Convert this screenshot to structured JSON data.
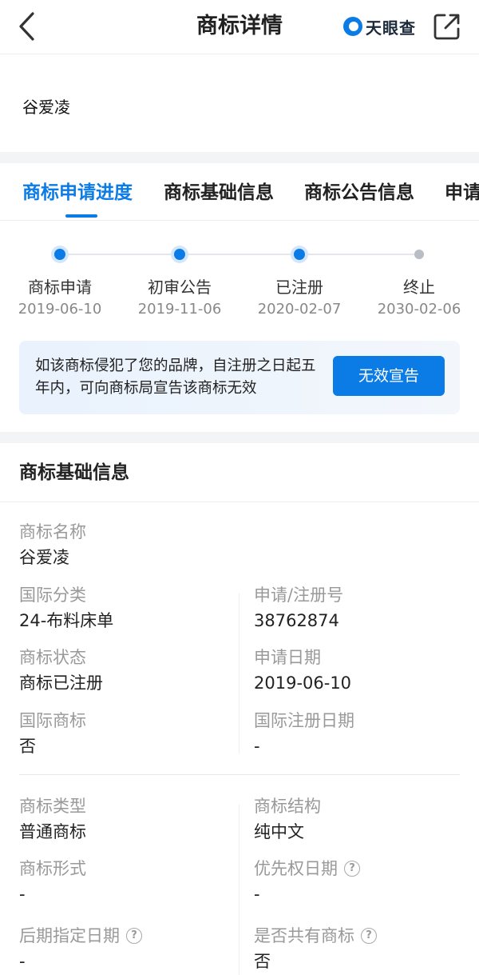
{
  "header": {
    "title": "商标详情",
    "brand_name": "天眼查",
    "back_icon": "chevron-left-icon",
    "share_icon": "share-out-icon"
  },
  "trademark": {
    "name_image_text": "谷爱凌"
  },
  "tabs": [
    {
      "label": "商标申请进度",
      "active": true
    },
    {
      "label": "商标基础信息",
      "active": false
    },
    {
      "label": "商标公告信息",
      "active": false
    },
    {
      "label": "申请",
      "active": false
    }
  ],
  "timeline": [
    {
      "label": "商标申请",
      "date": "2019-06-10",
      "done": true
    },
    {
      "label": "初审公告",
      "date": "2019-11-06",
      "done": true
    },
    {
      "label": "已注册",
      "date": "2020-02-07",
      "done": true
    },
    {
      "label": "终止",
      "date": "2030-02-06",
      "done": false
    }
  ],
  "notice": {
    "text": "如该商标侵犯了您的品牌，自注册之日起五年内，可向商标局宣告该商标无效",
    "button_label": "无效宣告"
  },
  "basic_info": {
    "section_title": "商标基础信息",
    "tm_name": {
      "label": "商标名称",
      "value": "谷爱凌"
    },
    "intl_class": {
      "label": "国际分类",
      "value": "24-布料床单"
    },
    "reg_no": {
      "label": "申请/注册号",
      "value": "38762874"
    },
    "status": {
      "label": "商标状态",
      "value": "商标已注册"
    },
    "apply_date": {
      "label": "申请日期",
      "value": "2019-06-10"
    },
    "intl_tm": {
      "label": "国际商标",
      "value": "否"
    },
    "intl_reg_date": {
      "label": "国际注册日期",
      "value": "-"
    },
    "tm_type": {
      "label": "商标类型",
      "value": "普通商标"
    },
    "tm_structure": {
      "label": "商标结构",
      "value": "纯中文"
    },
    "tm_form": {
      "label": "商标形式",
      "value": "-"
    },
    "priority_date": {
      "label": "优先权日期",
      "value": "-"
    },
    "later_designation_date": {
      "label": "后期指定日期",
      "value": "-"
    },
    "shared_tm": {
      "label": "是否共有商标",
      "value": "否"
    }
  },
  "colors": {
    "accent": "#0b7be6",
    "inactive_dot": "#b9bec5"
  }
}
